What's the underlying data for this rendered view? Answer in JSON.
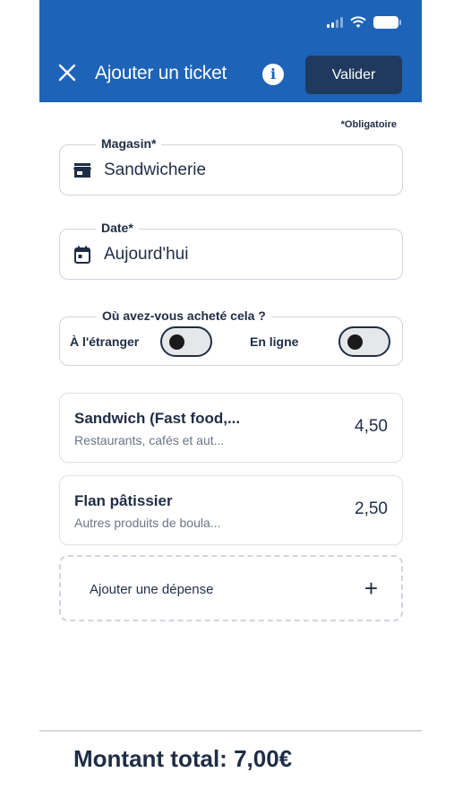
{
  "header": {
    "title": "Ajouter un ticket",
    "validate_label": "Valider",
    "info_glyph": "i"
  },
  "form": {
    "required_note": "*Obligatoire",
    "store": {
      "label": "Magasin*",
      "value": "Sandwicherie",
      "icon": "store-icon"
    },
    "date": {
      "label": "Date*",
      "value": "Aujourd'hui",
      "icon": "calendar-icon"
    },
    "purchase_place": {
      "label": "Où avez-vous acheté cela ?",
      "abroad_label": "À l'étranger",
      "abroad_on": false,
      "online_label": "En ligne",
      "online_on": false
    }
  },
  "expenses": [
    {
      "title": "Sandwich (Fast food,...",
      "category": "Restaurants, cafés et aut...",
      "amount": "4,50"
    },
    {
      "title": "Flan pâtissier",
      "category": "Autres produits de boula...",
      "amount": "2,50"
    }
  ],
  "add_expense": {
    "label": "Ajouter une dépense",
    "plus": "+"
  },
  "footer": {
    "total": "Montant total: 7,00€"
  },
  "colors": {
    "primary": "#1d63b8",
    "button_dark": "#1f3a5e",
    "text": "#1f2d45"
  }
}
